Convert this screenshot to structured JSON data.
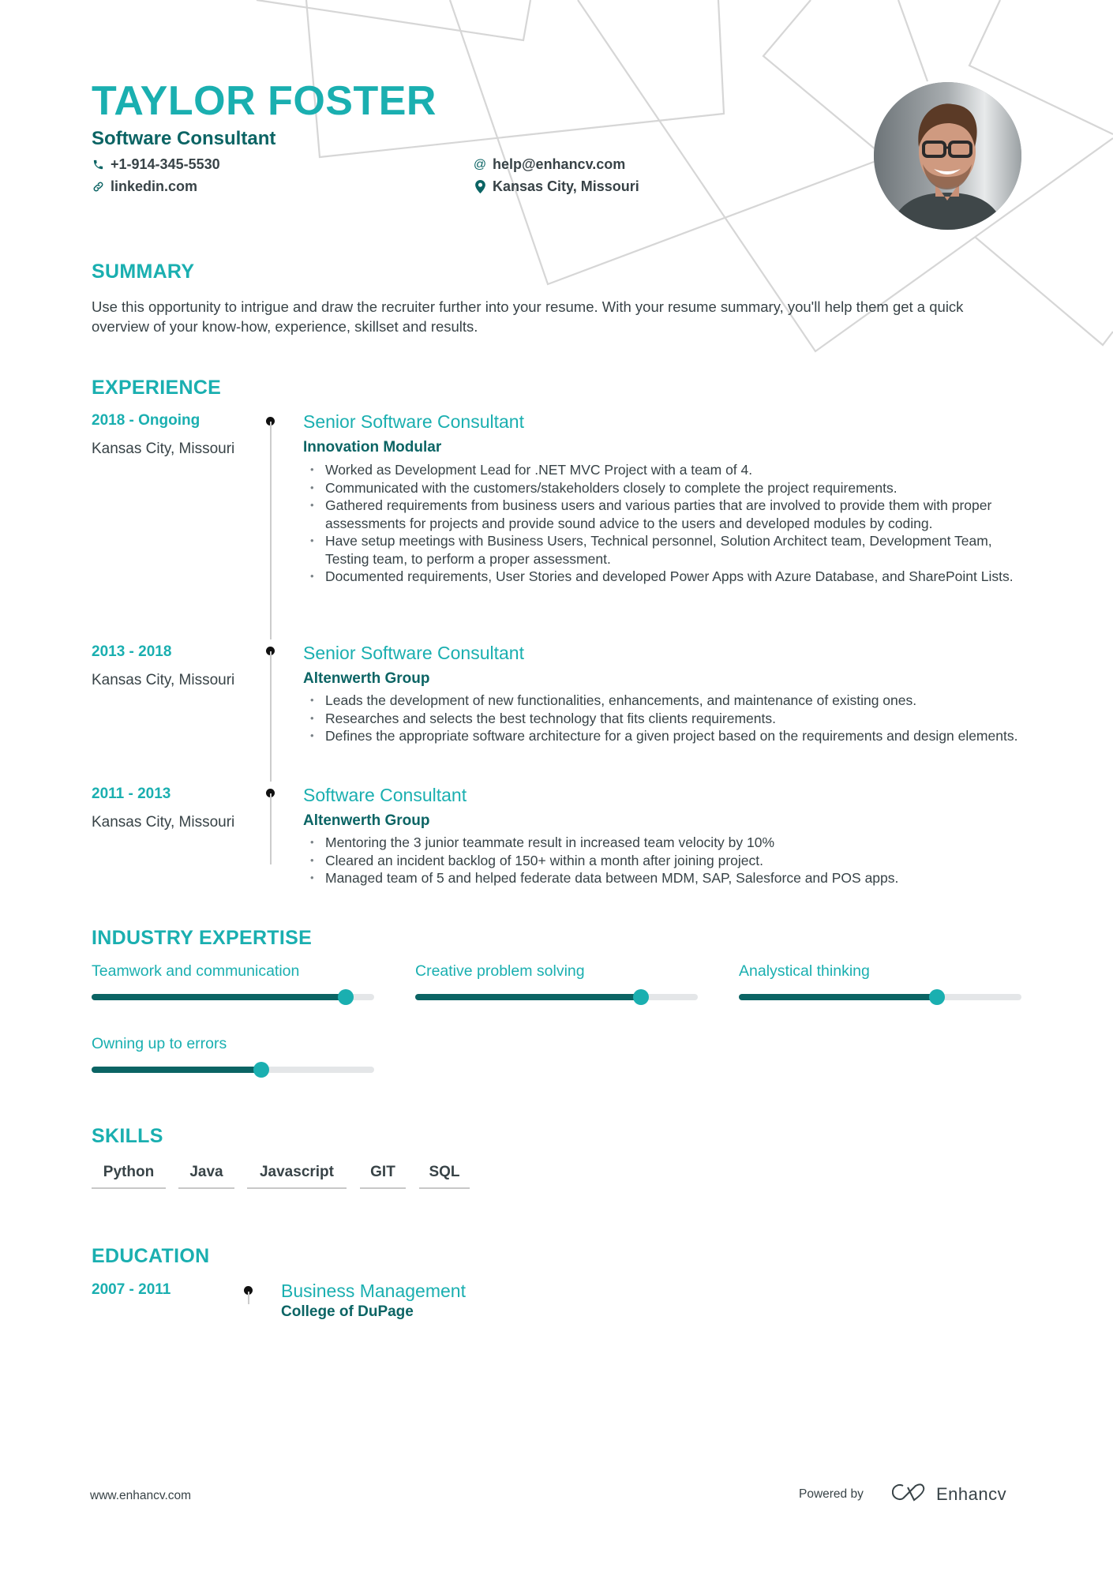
{
  "header": {
    "name": "TAYLOR FOSTER",
    "role": "Software Consultant",
    "contacts": {
      "phone": {
        "icon": "phone-icon",
        "value": "+1-914-345-5530"
      },
      "linkedin": {
        "icon": "link-icon",
        "value": "linkedin.com"
      },
      "email": {
        "icon": "at-icon",
        "value": "help@enhancv.com"
      },
      "location": {
        "icon": "location-pin-icon",
        "value": "Kansas City, Missouri"
      }
    },
    "photo_alt": "Profile photo"
  },
  "summary": {
    "title": "SUMMARY",
    "text": "Use this opportunity to intrigue and draw the recruiter further into your resume. With your resume summary, you'll help them get a quick overview of your know-how, experience, skillset and results."
  },
  "experience": {
    "title": "EXPERIENCE",
    "items": [
      {
        "dates": "2018 - Ongoing",
        "location": "Kansas City, Missouri",
        "title": "Senior Software Consultant",
        "company": "Innovation Modular",
        "bullets": [
          "Worked as Development Lead for .NET MVC Project with a team of 4.",
          "Communicated with the customers/stakeholders closely to complete the project requirements.",
          "Gathered requirements from business users and various parties that are involved to provide them with proper assessments for projects and provide sound advice to the users and developed modules by coding.",
          "Have setup meetings with Business Users, Technical personnel, Solution Architect team, Development Team, Testing team, to perform a proper assessment.",
          "Documented requirements, User Stories and developed Power Apps with Azure Database, and SharePoint Lists."
        ]
      },
      {
        "dates": "2013 - 2018",
        "location": "Kansas City, Missouri",
        "title": "Senior Software Consultant",
        "company": "Altenwerth Group",
        "bullets": [
          "Leads the development of new functionalities, enhancements, and maintenance of existing ones.",
          "Researches and selects the best technology that fits clients requirements.",
          "Defines the appropriate software architecture for a given project based on the requirements and design elements."
        ]
      },
      {
        "dates": "2011 - 2013",
        "location": "Kansas City, Missouri",
        "title": "Software Consultant",
        "company": "Altenwerth Group",
        "bullets": [
          "Mentoring the 3 junior teammate result in increased team velocity by 10%",
          "Cleared an incident backlog of 150+ within a month after joining project.",
          "Managed team of 5 and helped federate data between MDM, SAP, Salesforce and POS apps."
        ]
      }
    ]
  },
  "expertise": {
    "title": "INDUSTRY EXPERTISE",
    "items": [
      {
        "label": "Teamwork and communication",
        "level": 0.9
      },
      {
        "label": "Creative problem solving",
        "level": 0.8
      },
      {
        "label": "Analystical thinking",
        "level": 0.7
      },
      {
        "label": "Owning up to errors",
        "level": 0.6
      }
    ]
  },
  "skills": {
    "title": "SKILLS",
    "items": [
      "Python",
      "Java",
      "Javascript",
      "GIT",
      "SQL"
    ]
  },
  "education": {
    "title": "EDUCATION",
    "items": [
      {
        "dates": "2007 - 2011",
        "degree": "Business Management",
        "school": "College of DuPage"
      }
    ]
  },
  "footer": {
    "url": "www.enhancv.com",
    "powered_by": "Powered by",
    "brand": "Enhancv"
  },
  "colors": {
    "accent": "#1aafb0",
    "accent_dark": "#0b6464",
    "text": "#384347",
    "track": "#e4e6e8"
  }
}
